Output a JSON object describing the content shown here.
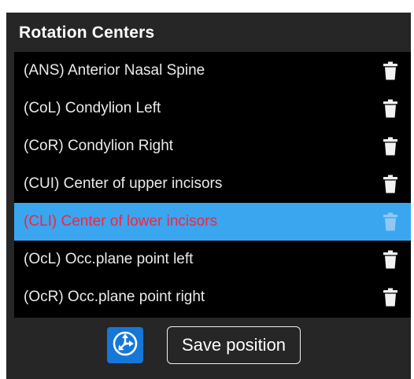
{
  "panel": {
    "title": "Rotation Centers"
  },
  "list": {
    "items": [
      {
        "label": "(ANS) Anterior Nasal Spine",
        "selected": false
      },
      {
        "label": "(CoL) Condylion Left",
        "selected": false
      },
      {
        "label": "(CoR) Condylion Right",
        "selected": false
      },
      {
        "label": "(CUI) Center of upper incisors",
        "selected": false
      },
      {
        "label": "(CLI) Center of lower incisors",
        "selected": true
      },
      {
        "label": "(OcL) Occ.plane point left",
        "selected": false
      },
      {
        "label": "(OcR) Occ.plane point right",
        "selected": false
      }
    ],
    "delete_icon": "trash-icon"
  },
  "footer": {
    "rotate_icon": "rotation-axes-icon",
    "save_label": "Save position"
  },
  "colors": {
    "panel_bg": "#262626",
    "list_bg": "#000000",
    "selected_bg": "#3aa6f0",
    "selected_text": "#ff1f3d",
    "button_blue": "#1577d8"
  }
}
